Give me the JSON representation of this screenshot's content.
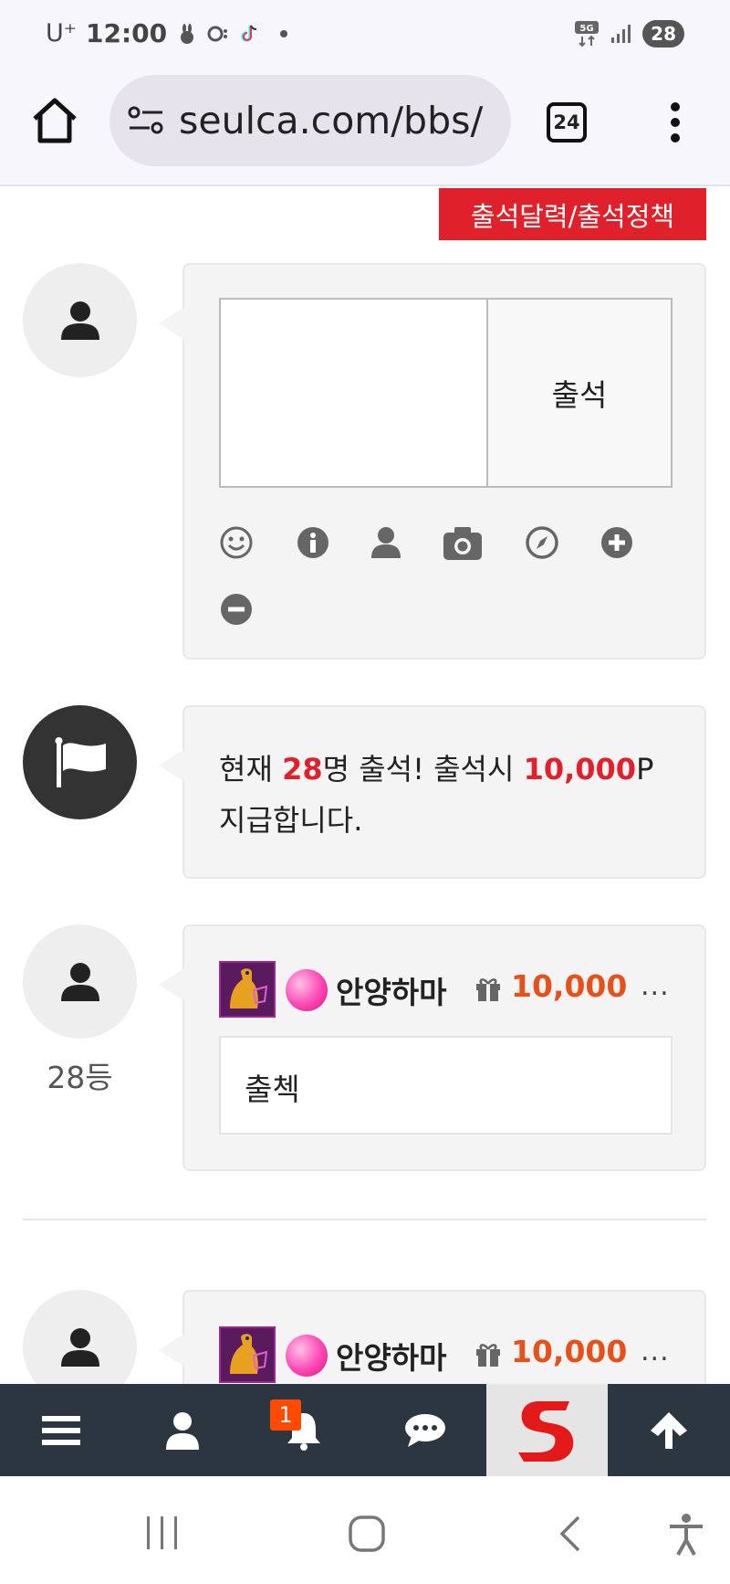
{
  "status_bar": {
    "carrier": "U⁺",
    "time": "12:00",
    "network": "5G",
    "battery": "28"
  },
  "browser": {
    "url": "seulca.com/bbs/",
    "tab_count": "24"
  },
  "attendance": {
    "policy_button_label": "출석달력/출석정책",
    "submit_label": "출석",
    "textarea_value": "",
    "tool_icons": [
      "smile-icon",
      "info-icon",
      "user-icon",
      "camera-icon",
      "compass-icon",
      "plus-circle-icon",
      "minus-circle-icon"
    ]
  },
  "notice": {
    "prefix": "현재 ",
    "count": "28",
    "middle": "명 출석! 출석시 ",
    "points": "10,000",
    "suffix": "P 지급합니다."
  },
  "entries": [
    {
      "rank": "28등",
      "username": "안양하마",
      "points": "10,000",
      "more": "...",
      "comment": "출첵"
    },
    {
      "rank": "",
      "username": "안양하마",
      "points": "10,000",
      "more": "...",
      "comment": ""
    }
  ],
  "site_nav": {
    "notification_count": "1",
    "items": [
      "menu-icon",
      "user-icon",
      "bell-icon",
      "chat-icon",
      "site-logo",
      "arrow-up-icon"
    ]
  },
  "colors": {
    "accent_red": "#e0202a",
    "points_orange": "#e8501a",
    "nav_bg": "#2b3640",
    "notif_orange": "#ff4a00"
  }
}
